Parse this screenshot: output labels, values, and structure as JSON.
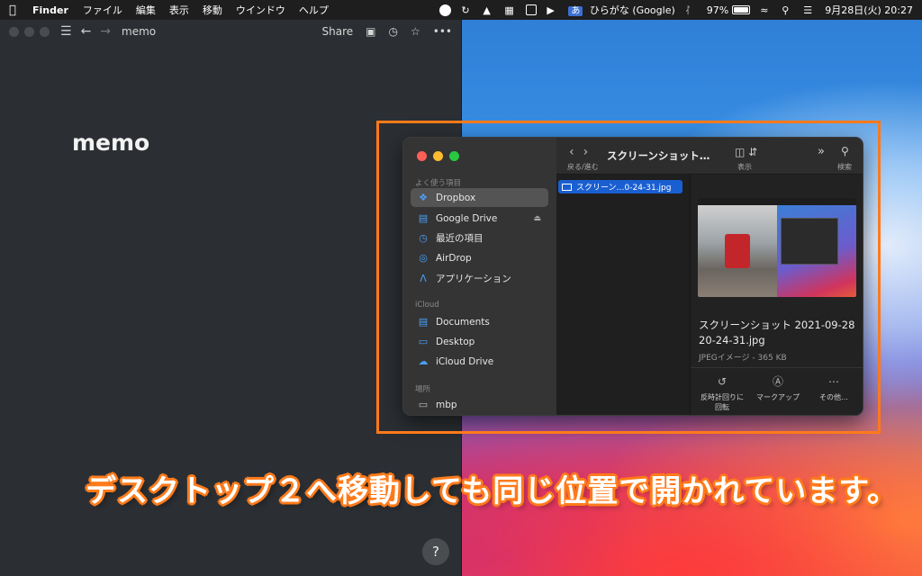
{
  "menubar": {
    "app_name": "Finder",
    "menus": [
      "ファイル",
      "編集",
      "表示",
      "移動",
      "ウインドウ",
      "ヘルプ"
    ],
    "ime_badge": "あ",
    "ime_label": "ひらがな (Google)",
    "battery_percent": "97%",
    "battery_level": 0.97,
    "datetime": "9月28日(火)  20:27"
  },
  "memo": {
    "breadcrumb": "memo",
    "share_label": "Share",
    "title": "memo",
    "help_label": "?"
  },
  "finder": {
    "sidebar": {
      "favorites_header": "よく使う項目",
      "favorites": [
        {
          "label": "Dropbox",
          "icon": "dropbox-icon"
        },
        {
          "label": "Google Drive",
          "icon": "google-drive-icon"
        },
        {
          "label": "最近の項目",
          "icon": "clock-icon"
        },
        {
          "label": "AirDrop",
          "icon": "airdrop-icon"
        },
        {
          "label": "アプリケーション",
          "icon": "applications-icon"
        }
      ],
      "icloud_header": "iCloud",
      "icloud": [
        {
          "label": "Documents",
          "icon": "document-icon"
        },
        {
          "label": "Desktop",
          "icon": "desktop-icon"
        },
        {
          "label": "iCloud Drive",
          "icon": "cloud-icon"
        }
      ],
      "locations_header": "場所",
      "locations": [
        {
          "label": "mbp",
          "icon": "laptop-icon"
        }
      ]
    },
    "toolbar": {
      "path_title": "スクリーンショット…",
      "nav_label": "戻る/進む",
      "view_label": "表示",
      "search_label": "検索"
    },
    "file_name": "スクリーン…0-24-31.jpg",
    "preview": {
      "name_line1": "スクリーンショット 2021-09-28",
      "name_line2": "20-24-31.jpg",
      "meta": "JPEGイメージ - 365 KB",
      "actions": [
        {
          "label_line1": "反時計回りに",
          "label_line2": "回転"
        },
        {
          "label_line1": "マークアップ",
          "label_line2": ""
        },
        {
          "label_line1": "その他…",
          "label_line2": ""
        }
      ]
    }
  },
  "caption": "デスクトップ２へ移動しても同じ位置で開かれています。"
}
